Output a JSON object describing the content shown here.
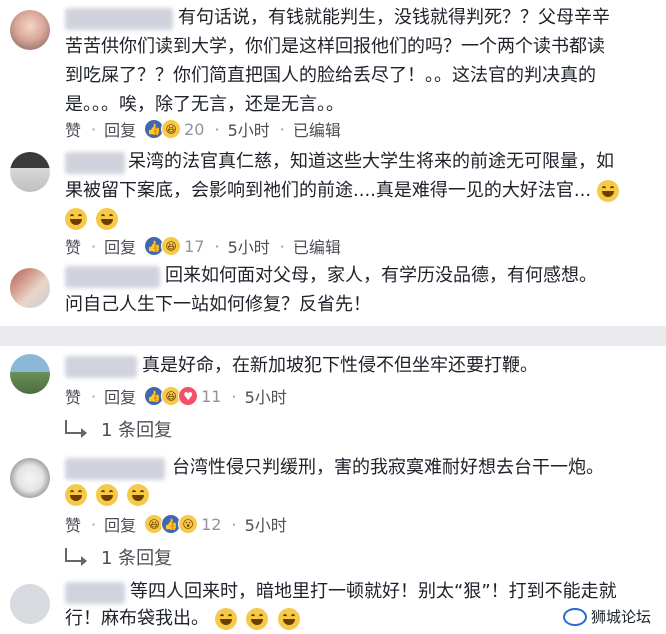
{
  "comments": [
    {
      "lines": [
        "有句话说，有钱就能判生，没钱就得判死？？父母辛辛",
        "苦苦供你们读到大学，你们是这样回报他们的吗？一个两个读书都读",
        "到吃屎了？？你们简直把国人的脸给丢尽了！。。这法官的判决真的",
        "是。。。唉，除了无言，还是无言。。"
      ],
      "actions": {
        "like": "赞",
        "reply": "回复",
        "count": "20",
        "time": "5小时",
        "edited": "已编辑"
      }
    },
    {
      "lines": [
        "呆湾的法官真仁慈，知道这些大学生将来的前途无可限量，如",
        "果被留下案底，会影响到祂们的前途....真是难得一见的大好法官..."
      ],
      "actions": {
        "like": "赞",
        "reply": "回复",
        "count": "17",
        "time": "5小时",
        "edited": "已编辑"
      }
    },
    {
      "lines": [
        "回来如何面对父母，家人，有学历没品德，有何感想。",
        "问自己人生下一站如何修复？反省先！"
      ]
    },
    {
      "lines": [
        "真是好命，在新加坡犯下性侵不但坐牢还要打鞭。"
      ],
      "actions": {
        "like": "赞",
        "reply": "回复",
        "count": "11",
        "time": "5小时"
      },
      "replies": "1 条回复"
    },
    {
      "lines": [
        "台湾性侵只判缓刑，害的我寂寞难耐好想去台干一炮。"
      ],
      "actions": {
        "like": "赞",
        "reply": "回复",
        "count": "12",
        "time": "5小时"
      },
      "replies": "1 条回复"
    },
    {
      "lines": [
        "等四人回来时，暗地里打一顿就好！别太“狠”！打到不能走就",
        "行！麻布袋我出。"
      ]
    }
  ],
  "watermark": "狮城论坛",
  "colors": {
    "text": "#1d2129",
    "secondary": "#4b4f56",
    "meta": "#90949c",
    "separator": "#e9ebee",
    "like": "#4267b2",
    "haha": "#f7c948"
  }
}
